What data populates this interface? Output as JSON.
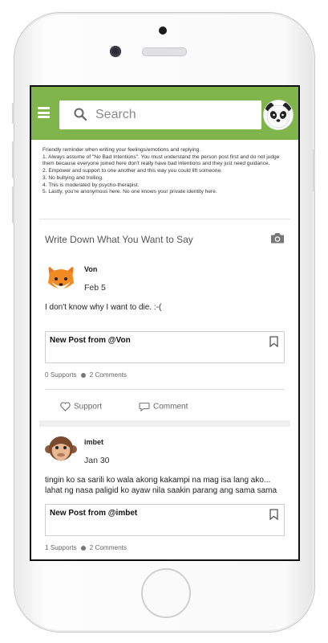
{
  "header": {
    "search_placeholder": "Search"
  },
  "notice": {
    "lines": [
      "Friendly reminder when writing your feelings/emotions and replying.",
      "1. Always assume of \"No Bad Intentions\". You must understand the person post first and do not judge them because everyone joined here don't really have bad intentions and they just need guidance.",
      "2. Empower and support to one another and this way you could lift someone.",
      "3. No bullying and trolling.",
      "4. This is moderated by psycho-therapist.",
      "5. Lastly, you're anonymous here. No one knows your private identity here."
    ]
  },
  "compose": {
    "prompt": "Write Down What You Want to Say"
  },
  "posts": [
    {
      "name": "Von",
      "date": "Feb 5",
      "text": "I don't know why I want to die. :-(",
      "share_title": "New Post from @Von",
      "supports": "0 Supports",
      "comments": "2 Comments",
      "support_label": "Support",
      "comment_label": "Comment"
    },
    {
      "name": "imbet",
      "date": "Jan 30",
      "text": "tingin  ko sa sarili ko wala akong kakampi na mag isa lang ako... lahat ng nasa paligid ko ayaw nila saakin parang ang sama sama kong tao",
      "share_title": "New Post from @imbet",
      "supports": "1 Supports",
      "comments": "2 Comments"
    }
  ],
  "icons": [
    "menu-icon",
    "search-icon",
    "panda-avatar",
    "camera-icon",
    "fox-avatar",
    "monkey-avatar",
    "bookmark-icon",
    "heart-icon",
    "comment-icon"
  ],
  "colors": {
    "appbar": "#7fb54a"
  }
}
